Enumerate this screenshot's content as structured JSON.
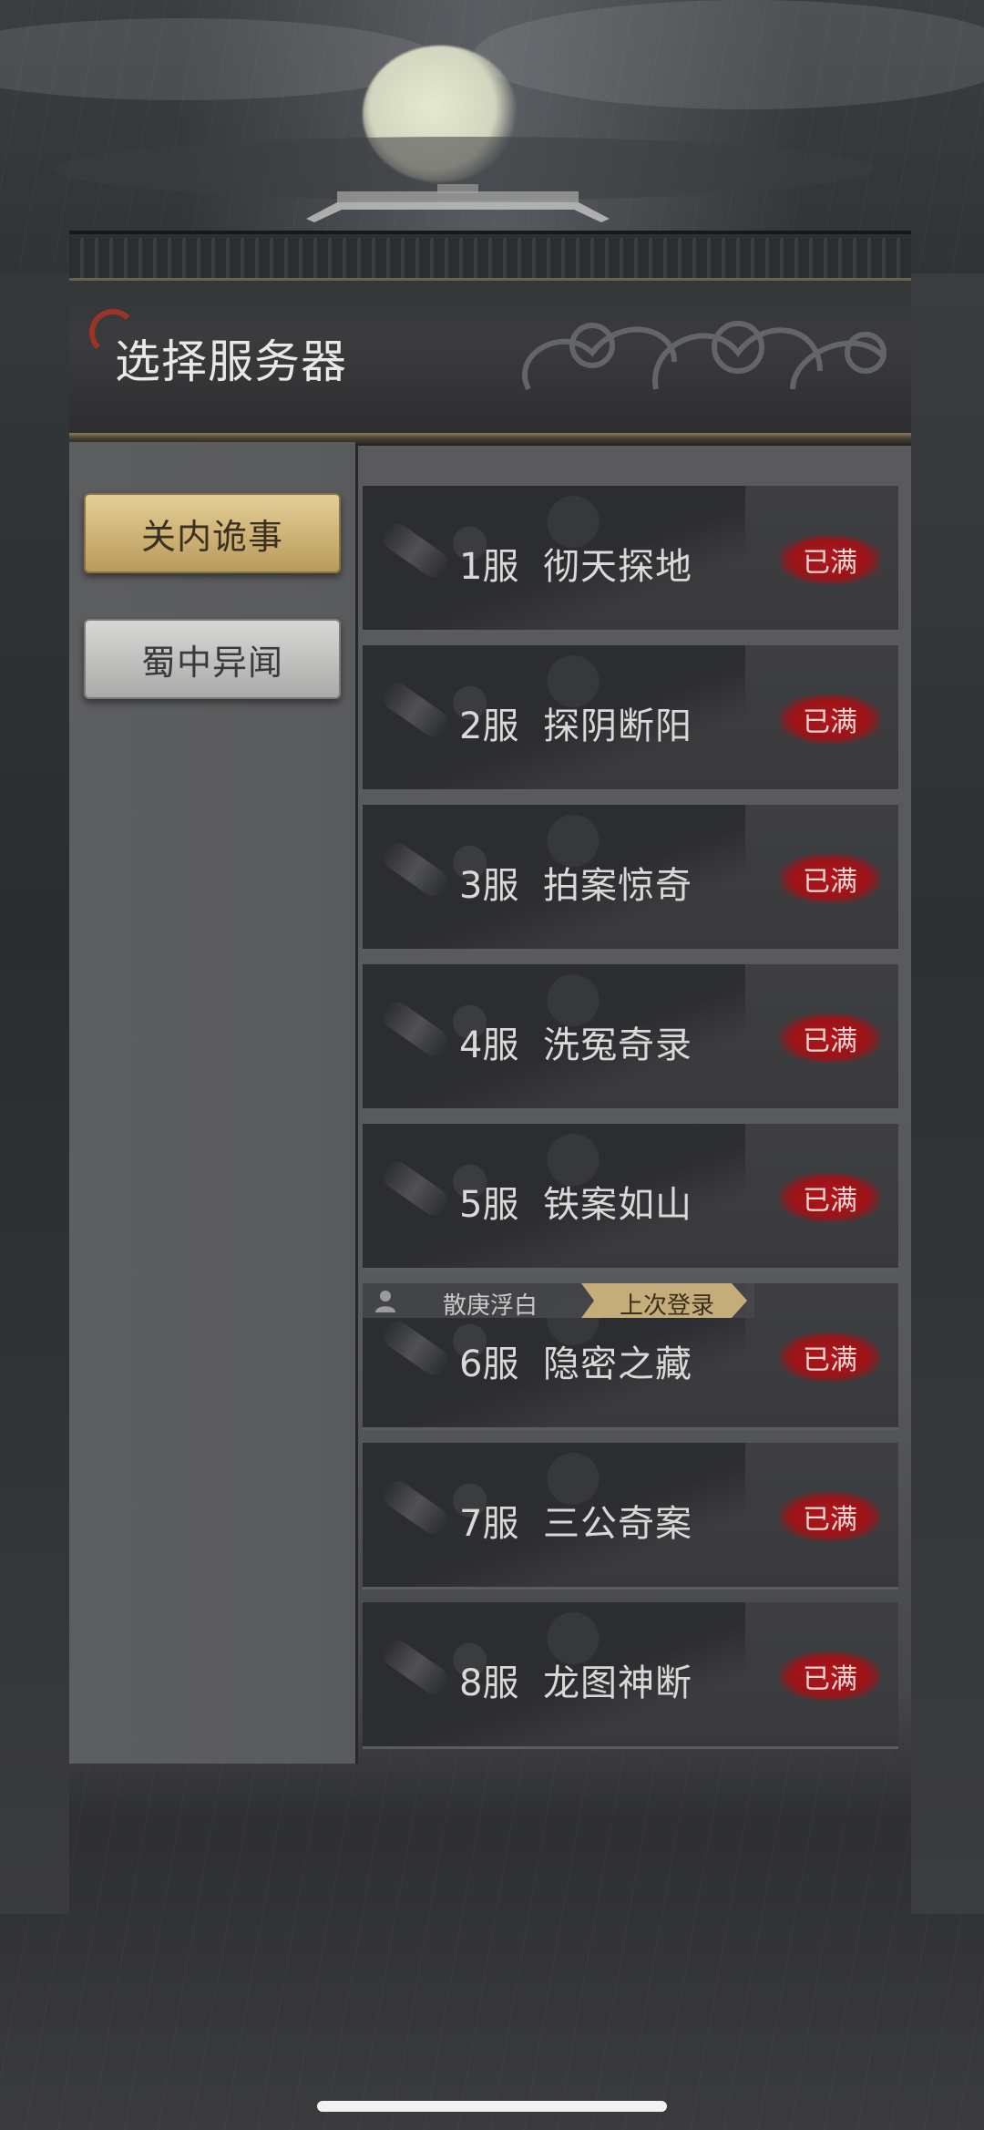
{
  "header": {
    "title": "选择服务器"
  },
  "categories": [
    {
      "label": "关内诡事",
      "active": true
    },
    {
      "label": "蜀中异闻",
      "active": false
    }
  ],
  "servers": [
    {
      "number": "1服",
      "name": "彻天探地",
      "status": "已满"
    },
    {
      "number": "2服",
      "name": "探阴断阳",
      "status": "已满"
    },
    {
      "number": "3服",
      "name": "拍案惊奇",
      "status": "已满"
    },
    {
      "number": "4服",
      "name": "洗冤奇录",
      "status": "已满"
    },
    {
      "number": "5服",
      "name": "铁案如山",
      "status": "已满"
    },
    {
      "number": "6服",
      "name": "隐密之藏",
      "status": "已满"
    },
    {
      "number": "7服",
      "name": "三公奇案",
      "status": "已满"
    },
    {
      "number": "8服",
      "name": "龙图神断",
      "status": "已满"
    }
  ],
  "last_login": {
    "character_name": "散庚浮白",
    "tag_label": "上次登录"
  },
  "colors": {
    "accent_gold": "#cfb478",
    "badge_red": "#b0161b",
    "panel_gray": "#5a5b5d",
    "row_dark": "#3e3f42"
  },
  "icons": {
    "user": "user-icon",
    "brush": "brush-icon"
  }
}
